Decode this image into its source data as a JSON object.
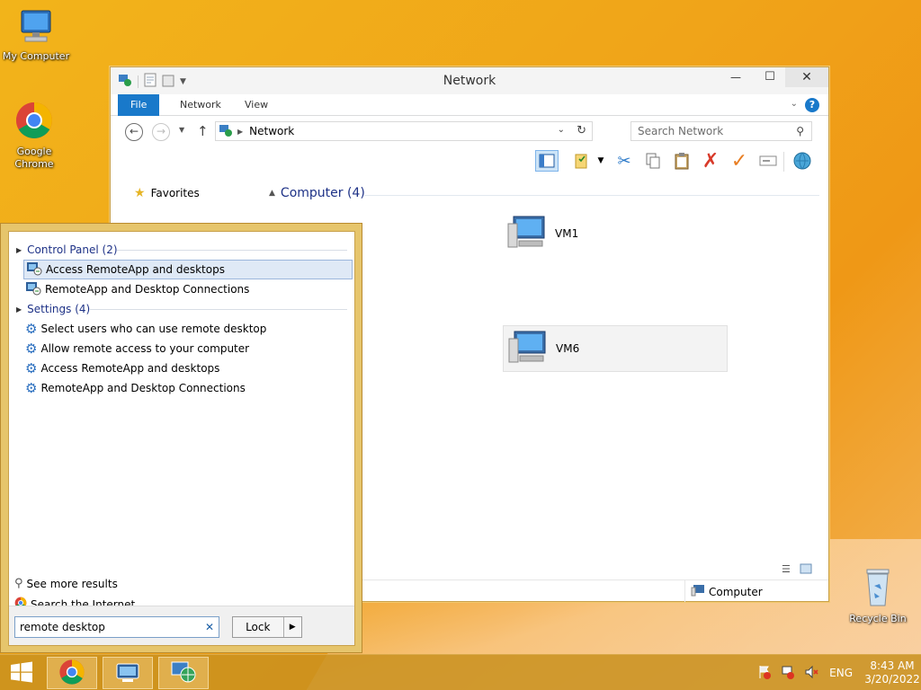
{
  "desktop": {
    "icons": [
      {
        "label": "My Computer"
      },
      {
        "label": "Google Chrome"
      },
      {
        "label": "Recycle Bin"
      }
    ]
  },
  "explorer": {
    "title": "Network",
    "tabs": [
      {
        "label": "File"
      },
      {
        "label": "Network"
      },
      {
        "label": "View"
      }
    ],
    "address": {
      "path": "Network"
    },
    "search_placeholder": "Search Network",
    "nav": {
      "favorites_label": "Favorites"
    },
    "group": {
      "label": "Computer (4)"
    },
    "items": [
      {
        "label": "VM1"
      },
      {
        "label": "VM6"
      }
    ],
    "status": {
      "selected_label": "Computer"
    }
  },
  "search_pane": {
    "sections": [
      {
        "label": "Control Panel (2)",
        "results": [
          {
            "label": "Access RemoteApp and desktops"
          },
          {
            "label": "RemoteApp and Desktop Connections"
          }
        ]
      },
      {
        "label": "Settings (4)",
        "results": [
          {
            "label": "Select users who can use remote desktop"
          },
          {
            "label": "Allow remote access to your computer"
          },
          {
            "label": "Access RemoteApp and desktops"
          },
          {
            "label": "RemoteApp and Desktop Connections"
          }
        ]
      }
    ],
    "see_more": "See more results",
    "search_internet": "Search the Internet",
    "query": "remote desktop",
    "lock_label": "Lock"
  },
  "taskbar": {
    "language": "ENG",
    "time": "8:43 AM",
    "date": "3/20/2022"
  },
  "colors": {
    "accent": "#1979ca",
    "desktop": "#f0a419",
    "group_text": "#1e3287"
  }
}
